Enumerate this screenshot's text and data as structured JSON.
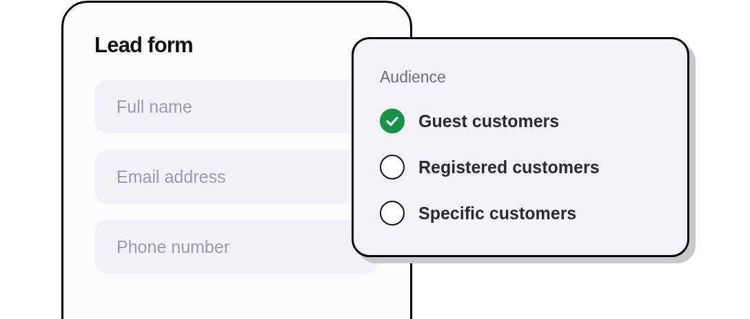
{
  "lead_form": {
    "title": "Lead form",
    "fields": [
      {
        "placeholder": "Full name"
      },
      {
        "placeholder": "Email address"
      },
      {
        "placeholder": "Phone number"
      }
    ]
  },
  "audience": {
    "title": "Audience",
    "options": [
      {
        "label": "Guest customers",
        "selected": true
      },
      {
        "label": "Registered customers",
        "selected": false
      },
      {
        "label": "Specific customers",
        "selected": false
      }
    ]
  }
}
